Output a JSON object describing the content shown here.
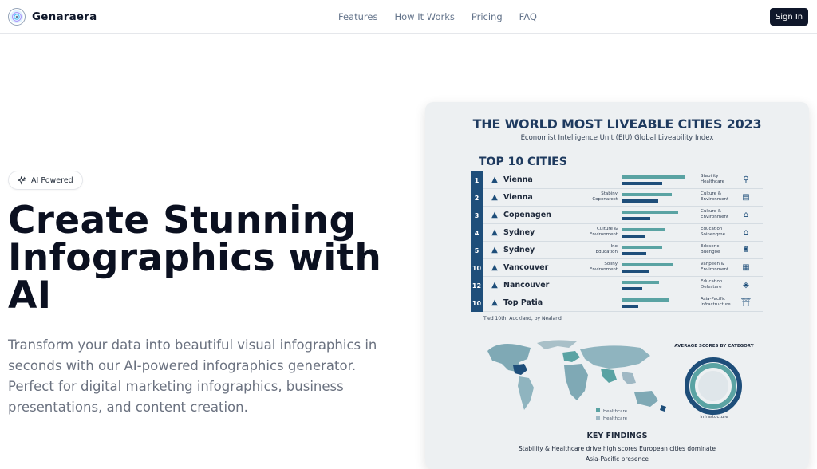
{
  "header": {
    "brand": "Genaraera",
    "nav": [
      "Features",
      "How It Works",
      "Pricing",
      "FAQ"
    ],
    "sign_in": "Sign In"
  },
  "hero": {
    "badge": "AI Powered",
    "headline_lines": [
      "Create Stunning",
      "Infographics with",
      "AI"
    ],
    "subtext_lines": [
      "Transform your data into beautiful visual infographics in",
      "seconds with our AI-powered infographics generator.",
      "Perfect for digital marketing infographics, business",
      "presentations, and content creation."
    ]
  },
  "infographic": {
    "title": "THE WORLD MOST LIVEABLE CITIES 2023",
    "subtitle": "Economist Intelligence Unit (EIU) Global Liveability Index",
    "top_heading": "TOP 10 CITIES",
    "rows": [
      {
        "rank": "1",
        "city": "Vienna",
        "left_note": "",
        "right_note": "Stability\nHealthcare",
        "bar1": 0.78,
        "bar2": 0.5,
        "icon": "bicycle-icon"
      },
      {
        "rank": "2",
        "city": "Vienna",
        "left_note": "Stabiny\nCopenarect",
        "right_note": "Culture &\nEnvironment",
        "bar1": 0.62,
        "bar2": 0.45,
        "icon": "building-icon"
      },
      {
        "rank": "3",
        "city": "Copenagen",
        "left_note": "",
        "right_note": "Culture &\nEnvironment",
        "bar1": 0.7,
        "bar2": 0.35,
        "icon": "museum-icon"
      },
      {
        "rank": "4",
        "city": "Sydney",
        "left_note": "Culture &\nEnvironment",
        "right_note": "Education\nSoinenqme",
        "bar1": 0.53,
        "bar2": 0.28,
        "icon": "house-icon"
      },
      {
        "rank": "5",
        "city": "Sydney",
        "left_note": "Ino\nEducation",
        "right_note": "Edoseric\nBuengoe",
        "bar1": 0.5,
        "bar2": 0.3,
        "icon": "castle-icon"
      },
      {
        "rank": "10",
        "city": "Vancouver",
        "left_note": "Sollny\nEnvironment",
        "right_note": "Vanpeen &\nEnvironment",
        "bar1": 0.64,
        "bar2": 0.33,
        "icon": "tower-icon"
      },
      {
        "rank": "12",
        "city": "Nancouver",
        "left_note": "",
        "right_note": "Education\nDelestare",
        "bar1": 0.46,
        "bar2": 0.25,
        "icon": "shield-icon"
      },
      {
        "rank": "10",
        "city": "Top Patia",
        "left_note": "",
        "right_note": "Asia-Pacific\nInfrastructure",
        "bar1": 0.59,
        "bar2": 0.2,
        "icon": "tori-icon"
      }
    ],
    "tied_note": "Tied 10th: Auckland, by Nealand",
    "map_legend": [
      "Healthcare",
      "Healthcare"
    ],
    "donut_title": "AVERAGE SCORES BY CATEGORY",
    "donut_label": "Infrastucture",
    "key_findings_title": "KEY FINDINGS",
    "key_findings_line1": "Stability & Healthcare drive high scores European cities dominate",
    "key_findings_line2": "Asia-Pacific presence",
    "colors": {
      "navy": "#1e4e7a",
      "teal": "#5aa3a3",
      "title": "#1e3a5f"
    }
  }
}
